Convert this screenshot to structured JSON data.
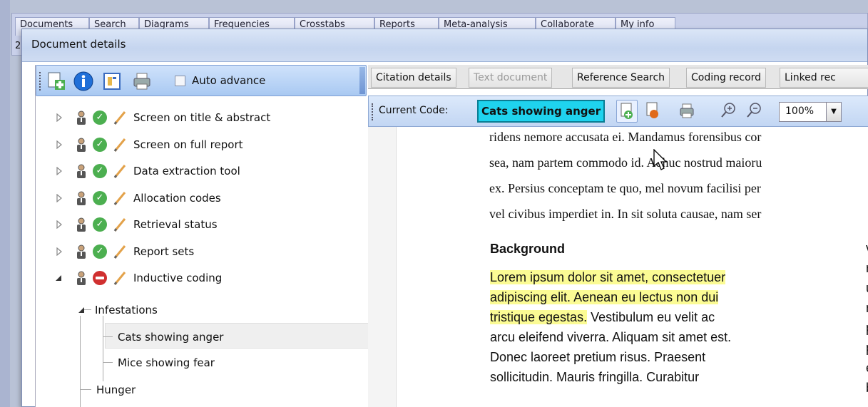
{
  "background_tabs": [
    "Documents",
    "Search",
    "Diagrams",
    "Frequencies",
    "Crosstabs",
    "Reports",
    "Meta-analysis",
    "Collaborate",
    "My info"
  ],
  "background_fragments": {
    "left_digit": "2"
  },
  "dialog": {
    "title": "Document details"
  },
  "left_toolbar": {
    "auto_advance_label": "Auto advance",
    "auto_advance_checked": false
  },
  "tree": {
    "items": [
      {
        "label": "Screen on title & abstract",
        "status": "complete"
      },
      {
        "label": "Screen on full report",
        "status": "complete"
      },
      {
        "label": "Data extraction tool",
        "status": "complete"
      },
      {
        "label": "Allocation codes",
        "status": "complete"
      },
      {
        "label": "Retrieval status",
        "status": "complete"
      },
      {
        "label": "Report sets",
        "status": "complete"
      },
      {
        "label": "Inductive coding",
        "status": "incomplete"
      }
    ],
    "children": {
      "infestations": "Infestations",
      "cats": "Cats showing anger",
      "mice": "Mice showing fear",
      "hunger": "Hunger"
    }
  },
  "right_tabs": [
    {
      "label": "Citation details",
      "disabled": false
    },
    {
      "label": "Text document",
      "disabled": true
    },
    {
      "label": "Reference Search",
      "disabled": false
    },
    {
      "label": "Coding record",
      "disabled": false
    },
    {
      "label": "Linked rec",
      "disabled": false
    }
  ],
  "right_toolbar": {
    "current_code_label": "Current Code:",
    "current_code_value": "Cats showing anger",
    "zoom_value": "100%"
  },
  "document": {
    "lines": [
      "ridens nemore accusata ei. Mandamus forensibus cor",
      "sea, nam partem commodo id. Adhuc nostrud maioru",
      "ex. Persius conceptam te quo, mel novum facilisi per",
      "vel civibus imperdiet in. In sit soluta causae, nam ser"
    ],
    "heading": "Background",
    "body_lines": [
      {
        "highlight": "Lorem ipsum dolor sit amet, consectetuer",
        "rest": ""
      },
      {
        "highlight": "adipiscing elit. Aenean eu lectus non dui",
        "rest": ""
      },
      {
        "highlight": "tristique egestas.",
        "rest": " Vestibulum eu velit ac"
      },
      {
        "highlight": "",
        "rest": "arcu eleifend viverra. Aliquam sit amet est."
      },
      {
        "highlight": "",
        "rest": "Donec laoreet pretium risus. Praesent"
      },
      {
        "highlight": "",
        "rest": "sollicitudin. Mauris fringilla. Curabitur"
      }
    ],
    "second_column": [
      "ve",
      "ris",
      "ult",
      "ne",
      "pe",
      "pla",
      "er",
      "bil"
    ]
  },
  "colors": {
    "current_code_bg": "#1fd3ee",
    "highlight": "#fbfb94",
    "ok_green": "#4caf50",
    "stop_red": "#d03030"
  }
}
